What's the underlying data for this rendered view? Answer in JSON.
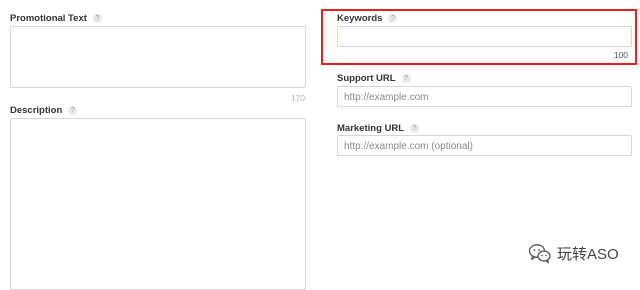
{
  "promotional_text": {
    "label": "Promotional Text",
    "help": "?",
    "counter": "170"
  },
  "description": {
    "label": "Description",
    "help": "?"
  },
  "keywords": {
    "label": "Keywords",
    "help": "?",
    "counter": "100"
  },
  "support_url": {
    "label": "Support URL",
    "help": "?",
    "placeholder": "http://example.com"
  },
  "marketing_url": {
    "label": "Marketing URL",
    "help": "?",
    "placeholder": "http://example.com (optional)"
  },
  "watermark": {
    "text": "玩转ASO",
    "icon": "wechat-icon"
  },
  "colors": {
    "highlight": "#e3231e",
    "border": "#d6d6d6",
    "label": "#333333",
    "help_bg": "#e9e9e9"
  }
}
